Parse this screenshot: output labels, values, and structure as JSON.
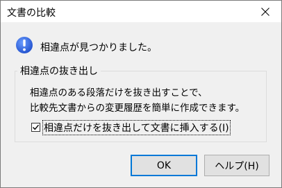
{
  "window": {
    "title": "文書の比較"
  },
  "message": "相違点が見つかりました。",
  "group": {
    "title": "相違点の抜き出し",
    "line1": "相違点のある段落だけを抜き出すことで、",
    "line2": "比較先文書からの変更履歴を簡単に作成できます。"
  },
  "option": {
    "label": "相違点だけを抜き出して文書に挿入する(I)",
    "checked": true
  },
  "buttons": {
    "ok": "OK",
    "help": "ヘルプ(H)"
  },
  "colors": {
    "info_icon": "#2b5fd9",
    "focus_border": "#0078d7"
  }
}
